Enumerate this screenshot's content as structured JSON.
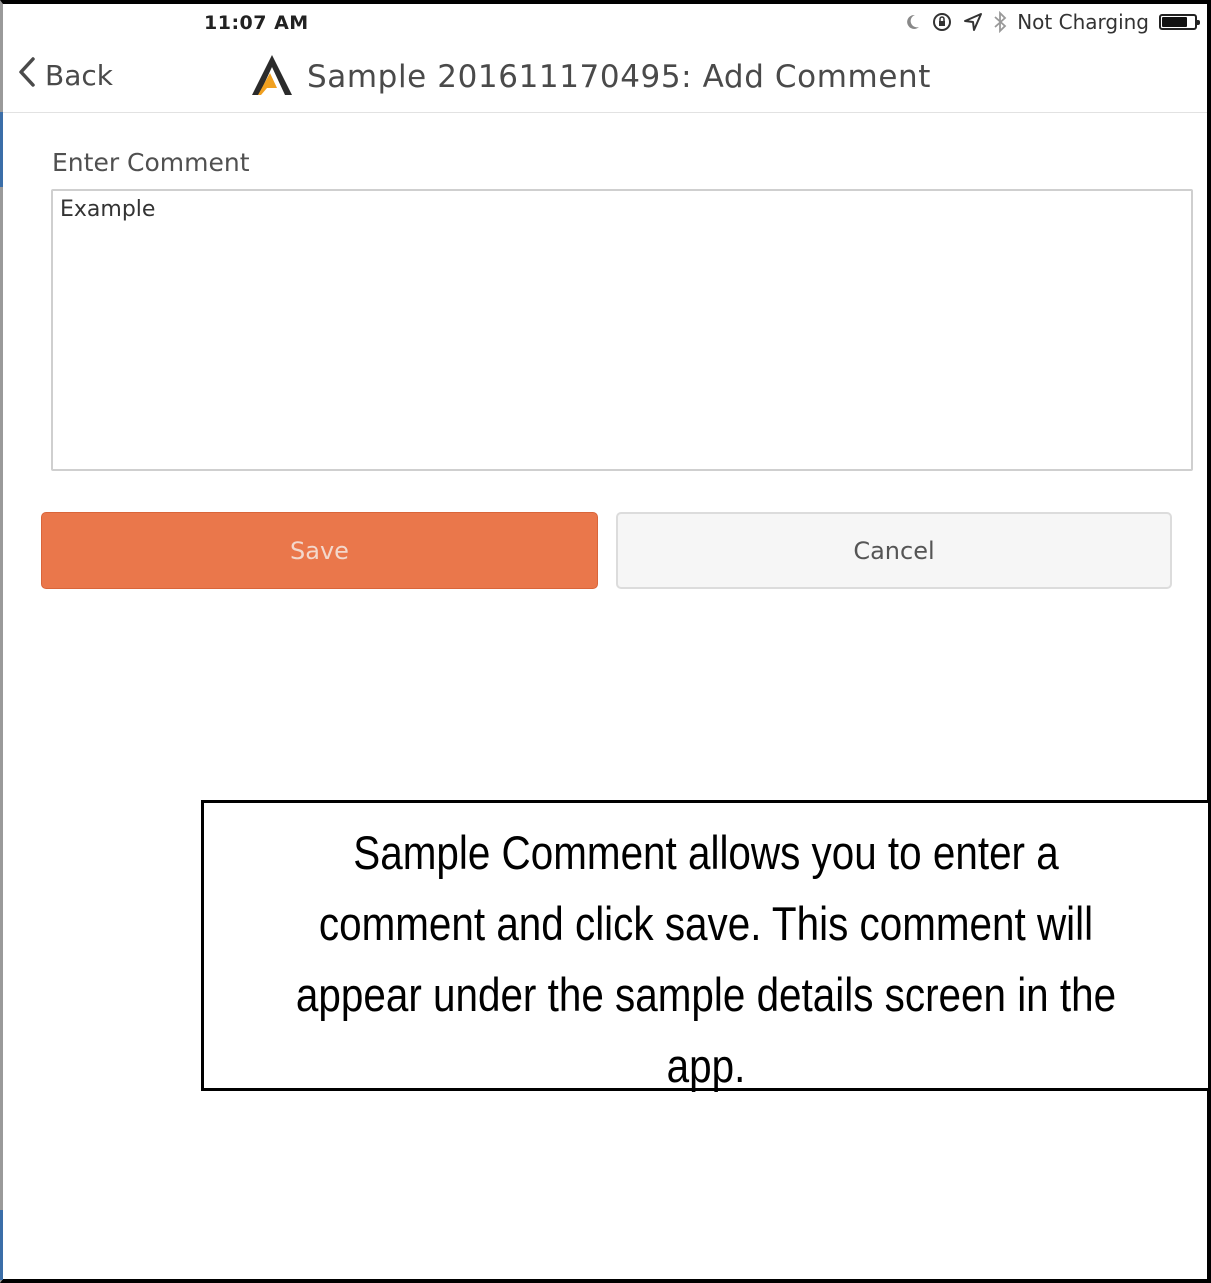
{
  "status_bar": {
    "time": "11:07 AM",
    "icons": [
      "moon-icon",
      "orientation-lock-icon",
      "location-arrow-icon",
      "bluetooth-icon",
      "battery-icon"
    ],
    "charging_status": "Not Charging",
    "battery_level": 0.8
  },
  "nav": {
    "back_label": "Back",
    "title": "Sample 201611170495: Add Comment",
    "logo_icon": "app-logo-icon"
  },
  "form": {
    "comment_label": "Enter Comment",
    "comment_value": "Example"
  },
  "buttons": {
    "save_label": "Save",
    "cancel_label": "Cancel"
  },
  "colors": {
    "save_button": "#ea774b",
    "cancel_button": "#f6f6f6",
    "logo_orange": "#f0a020"
  },
  "callout": {
    "text": "Sample Comment allows you to enter a comment and click save. This comment will appear under the sample details screen in the app."
  }
}
